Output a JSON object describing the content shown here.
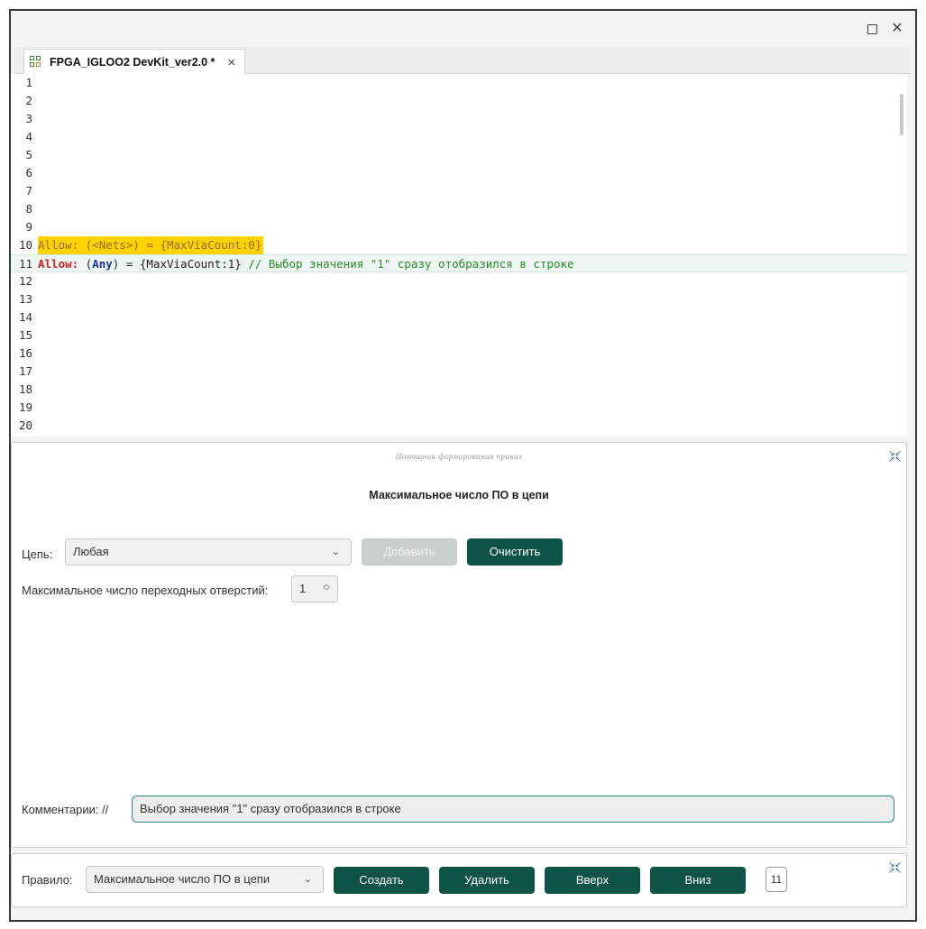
{
  "window": {
    "maximize_icon": "maximize-icon",
    "close_icon": "close-icon"
  },
  "tab": {
    "label": "FPGA_IGLOO2 DevKit_ver2.0 *",
    "icon": "project-grid-icon",
    "close": "×"
  },
  "editor": {
    "line_numbers": [
      "1",
      "2",
      "3",
      "4",
      "5",
      "6",
      "7",
      "8",
      "9",
      "10",
      "11",
      "12",
      "13",
      "14",
      "15",
      "16",
      "17",
      "18",
      "19",
      "20"
    ],
    "line10": {
      "kw": "Allow:",
      "rest": " (<Nets>) = {MaxViaCount:0}"
    },
    "line11": {
      "kw": "Allow:",
      "p_open": " (",
      "target": "Any",
      "p_close": ") = ",
      "value": "{MaxViaCount:1}",
      "comment": " // Выбор значения \"1\" сразу отобразился в строке"
    }
  },
  "helper": {
    "title": "Помощник формирования правил",
    "heading": "Максимальное число ПО в цепи",
    "net_label": "Цепь:",
    "net_value": "Любая",
    "add_button": "Добавить",
    "clear_button": "Очистить",
    "max_via_label": "Максимальное число переходных отверстий:",
    "max_via_value": "1",
    "comment_label": "Комментарии: //",
    "comment_value": "Выбор значения \"1\" сразу отобразился в строке"
  },
  "rulebar": {
    "rule_label": "Правило:",
    "rule_value": "Максимальное число ПО в цепи",
    "create_button": "Создать",
    "delete_button": "Удалить",
    "up_button": "Вверх",
    "down_button": "Вниз",
    "count": "11"
  },
  "colors": {
    "accent": "#0d5447",
    "highlight": "#ffd200",
    "keyword_red": "#d22020",
    "comment_green": "#2a8a2a"
  }
}
